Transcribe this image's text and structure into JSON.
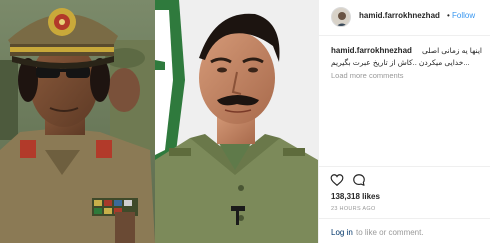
{
  "post": {
    "username": "hamid.farrokhnezhad",
    "follow_separator": "•",
    "follow_label": "Follow",
    "caption_user": "hamid.farrokhnezhad",
    "caption_line1": "اینها یه زمانی اصلی",
    "caption_line2": "...خدایی میکردن ..کاش از تاریخ عبرت بگیریم",
    "load_more": "Load more comments",
    "likes": "138,318 likes",
    "time": "23 HOURS AGO",
    "login_link": "Log in",
    "login_rest": "to like or comment."
  },
  "icons": {
    "like": "heart-icon",
    "comment": "comment-icon",
    "avatar": "profile-avatar"
  },
  "colors": {
    "link_blue": "#3897f0",
    "login_blue": "#003569",
    "muted": "#999999",
    "text": "#262626",
    "border": "#efefef"
  }
}
